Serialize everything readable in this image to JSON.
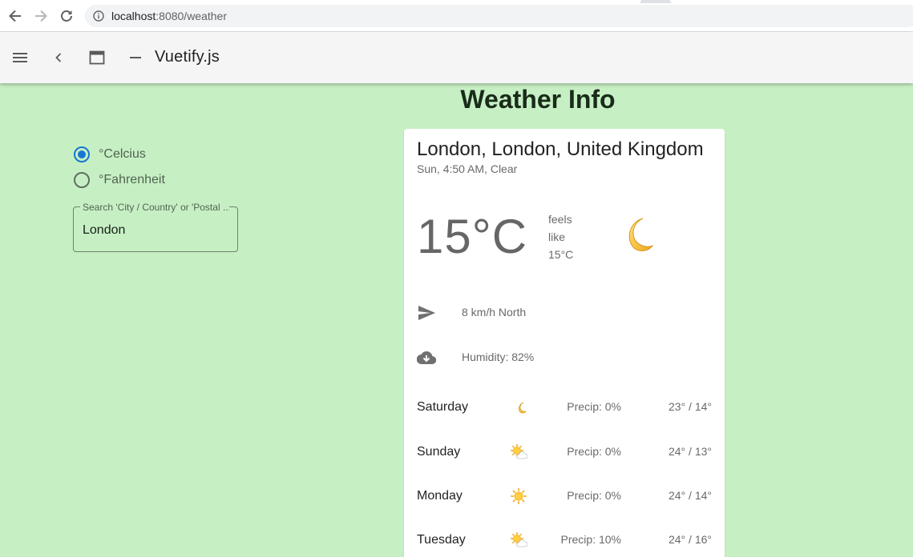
{
  "browser": {
    "url_host": "localhost",
    "url_path": ":8080/weather"
  },
  "app_bar": {
    "title": "Vuetify.js"
  },
  "page": {
    "title": "Weather Info"
  },
  "units": {
    "celsius_label": "°Celcius",
    "fahrenheit_label": "°Fahrenheit",
    "selected": "celsius"
  },
  "search": {
    "label": "Search 'City / Country' or 'Postal ...",
    "value": "London"
  },
  "weather": {
    "location": "London, London, United Kingdom",
    "subtitle": "Sun, 4:50 AM, Clear",
    "temperature": "15°C",
    "feels_like_line1": "feels",
    "feels_like_line2": "like",
    "feels_like_value": "15°C",
    "current_icon": "crescent-moon-icon",
    "wind": "8 km/h North",
    "humidity": "Humidity: 82%"
  },
  "forecast": [
    {
      "day": "Saturday",
      "icon": "crescent-moon-icon",
      "precip": "Precip: 0%",
      "temps": "23° / 14°"
    },
    {
      "day": "Sunday",
      "icon": "sun-behind-cloud-icon",
      "precip": "Precip: 0%",
      "temps": "24° / 13°"
    },
    {
      "day": "Monday",
      "icon": "sun-icon",
      "precip": "Precip: 0%",
      "temps": "24° / 14°"
    },
    {
      "day": "Tuesday",
      "icon": "sun-behind-cloud-icon",
      "precip": "Precip: 10%",
      "temps": "24° / 16°"
    }
  ],
  "colors": {
    "page_background": "#c6f0c4",
    "accent": "#1976d2",
    "app_bar": "#f5f5f5"
  }
}
